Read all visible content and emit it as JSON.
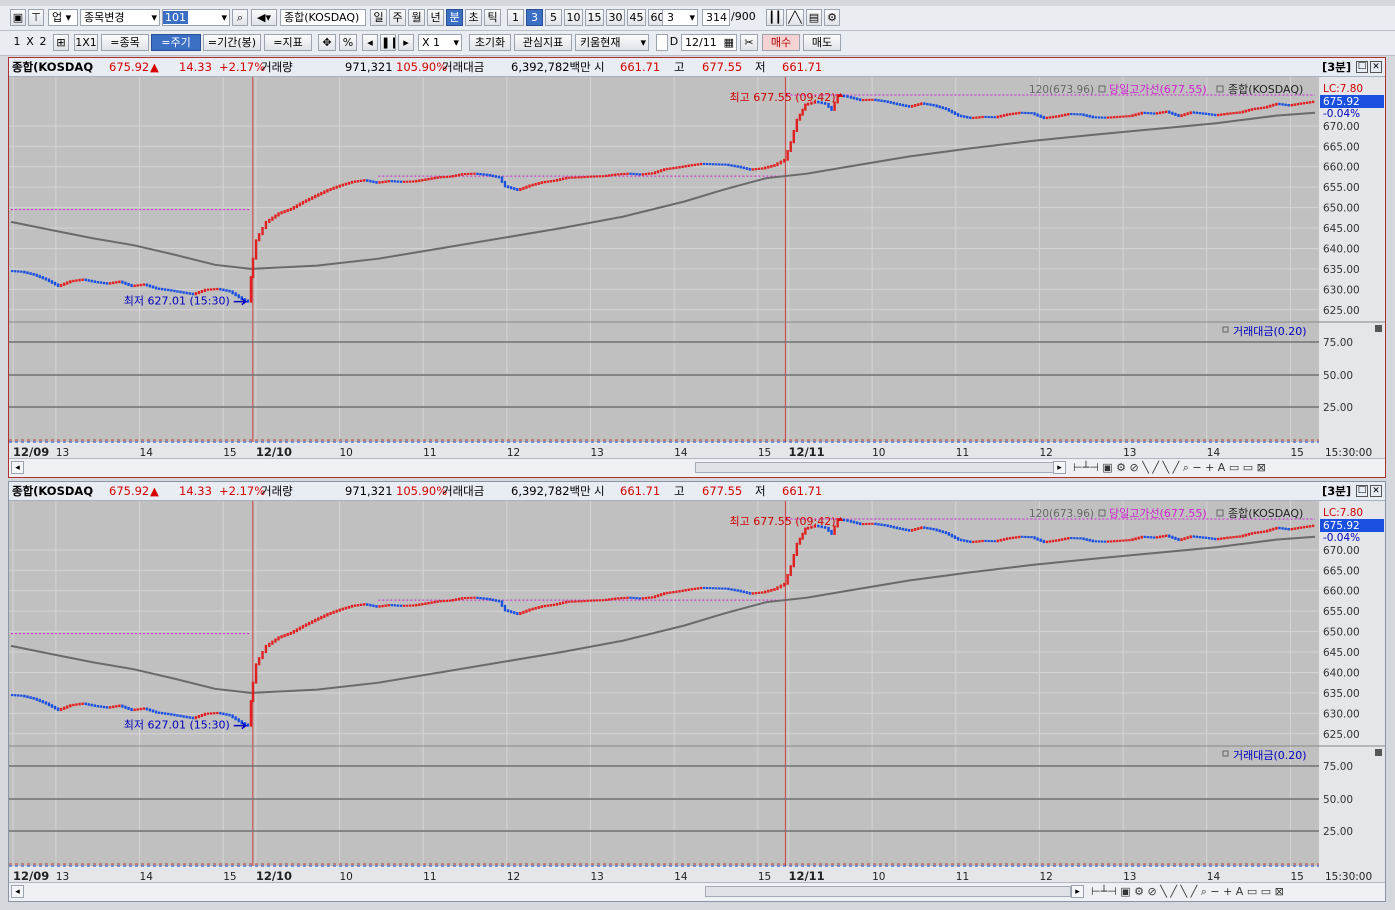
{
  "toolbar1": {
    "market_type": "업",
    "symbol_change_label": "종목변경",
    "symbol_code": "101",
    "symbol_name": "종합(KOSDAQ)",
    "period_buttons": [
      "일",
      "주",
      "월",
      "년",
      "분",
      "초",
      "틱"
    ],
    "period_selected": "분",
    "interval_buttons": [
      "1",
      "3",
      "5",
      "10",
      "15",
      "30",
      "45",
      "60"
    ],
    "interval_selected": "3",
    "interval_value": "3",
    "count_current": "314",
    "count_max": "/900"
  },
  "toolbar2": {
    "layout_1": "1",
    "layout_x": "X",
    "layout_2": "2",
    "layout_1x1": "1X1",
    "btn_symbol": "=종목",
    "btn_period": "=주기",
    "btn_range": "=기간(봉)",
    "btn_indicator": "=지표",
    "percent": "%",
    "zoom": "X 1",
    "btn_reset": "초기화",
    "btn_watch": "관심지표",
    "btn_kiwoom": "키움현재",
    "date_prefix": "D",
    "date_value": "12/11",
    "btn_buy": "매수",
    "btn_sell": "매도"
  },
  "panels": [
    {
      "header": {
        "name": "종합(KOSDAQ",
        "price": "675.92",
        "arrow": "▲",
        "change": "14.33",
        "change_pct": "+2.17%",
        "volume_label": "거래량",
        "volume": "971,321",
        "volume_ratio": "105.90%",
        "amount_label": "거래대금",
        "amount": "6,392,782백만",
        "open_label": "시",
        "open": "661.71",
        "high_label": "고",
        "high": "677.55",
        "low_label": "저",
        "low": "661.71",
        "interval_tag": "[3분]"
      }
    },
    {
      "header": {
        "name": "종합(KOSDAQ",
        "price": "675.92",
        "arrow": "▲",
        "change": "14.33",
        "change_pct": "+2.17%",
        "volume_label": "거래량",
        "volume": "971,321",
        "volume_ratio": "105.90%",
        "amount_label": "거래대금",
        "amount": "6,392,782백만",
        "open_label": "시",
        "open": "661.71",
        "high_label": "고",
        "high": "677.55",
        "low_label": "저",
        "low": "661.71",
        "interval_tag": "[3분]"
      }
    }
  ],
  "chart_data": {
    "type": "candlestick",
    "y_range": [
      622.5,
      680
    ],
    "y_ticks": [
      "670.00",
      "665.00",
      "660.00",
      "655.00",
      "650.00",
      "645.00",
      "640.00",
      "635.00",
      "630.00",
      "625.00"
    ],
    "current_label": "675.92",
    "lc_label": "LC:7.80",
    "change_label": "-0.04%",
    "high_annotation": "최고 677.55 (09:42)",
    "low_annotation": "최저 627.01 (15:30)",
    "ma_legend": "120(673.96)",
    "highline_legend": "당일고가선(677.55)",
    "series_legend": "종합(KOSDAQ)",
    "price_path": [
      [
        0,
        634.5
      ],
      [
        12,
        634.3
      ],
      [
        24,
        633.6
      ],
      [
        36,
        632.4
      ],
      [
        48,
        630.8
      ],
      [
        60,
        632.0
      ],
      [
        72,
        632.4
      ],
      [
        84,
        631.8
      ],
      [
        96,
        631.4
      ],
      [
        108,
        631.9
      ],
      [
        120,
        630.8
      ],
      [
        132,
        631.2
      ],
      [
        144,
        630.2
      ],
      [
        156,
        629.8
      ],
      [
        168,
        629.3
      ],
      [
        180,
        628.8
      ],
      [
        192,
        629.9
      ],
      [
        204,
        630.1
      ],
      [
        216,
        629.5
      ],
      [
        228,
        627.6
      ],
      [
        234,
        627.0
      ],
      [
        236,
        633.0
      ],
      [
        242,
        642.0
      ],
      [
        252,
        646.5
      ],
      [
        264,
        648.6
      ],
      [
        276,
        649.7
      ],
      [
        288,
        651.4
      ],
      [
        300,
        652.9
      ],
      [
        312,
        654.3
      ],
      [
        324,
        655.4
      ],
      [
        336,
        656.3
      ],
      [
        348,
        656.7
      ],
      [
        360,
        656.1
      ],
      [
        372,
        656.5
      ],
      [
        384,
        656.3
      ],
      [
        396,
        656.4
      ],
      [
        408,
        656.9
      ],
      [
        420,
        657.4
      ],
      [
        432,
        657.6
      ],
      [
        444,
        658.2
      ],
      [
        456,
        658.3
      ],
      [
        468,
        658.0
      ],
      [
        480,
        657.4
      ],
      [
        486,
        655.2
      ],
      [
        498,
        654.3
      ],
      [
        510,
        655.4
      ],
      [
        522,
        656.2
      ],
      [
        534,
        656.6
      ],
      [
        546,
        657.3
      ],
      [
        558,
        657.4
      ],
      [
        570,
        657.6
      ],
      [
        582,
        657.7
      ],
      [
        594,
        658.1
      ],
      [
        606,
        658.3
      ],
      [
        618,
        658.1
      ],
      [
        630,
        658.4
      ],
      [
        642,
        659.4
      ],
      [
        654,
        659.8
      ],
      [
        666,
        660.3
      ],
      [
        678,
        660.7
      ],
      [
        690,
        660.6
      ],
      [
        702,
        660.5
      ],
      [
        714,
        660.0
      ],
      [
        726,
        659.3
      ],
      [
        738,
        659.6
      ],
      [
        750,
        660.4
      ],
      [
        760,
        661.7
      ],
      [
        766,
        666.0
      ],
      [
        772,
        671.5
      ],
      [
        780,
        675.2
      ],
      [
        790,
        675.9
      ],
      [
        800,
        675.4
      ],
      [
        806,
        673.9
      ],
      [
        812,
        677.55
      ],
      [
        822,
        677.1
      ],
      [
        834,
        676.3
      ],
      [
        846,
        676.4
      ],
      [
        858,
        676.0
      ],
      [
        870,
        675.3
      ],
      [
        882,
        674.7
      ],
      [
        894,
        675.5
      ],
      [
        906,
        675.0
      ],
      [
        918,
        674.1
      ],
      [
        930,
        672.5
      ],
      [
        942,
        671.9
      ],
      [
        954,
        672.2
      ],
      [
        966,
        672.1
      ],
      [
        978,
        672.8
      ],
      [
        990,
        673.2
      ],
      [
        1002,
        673.1
      ],
      [
        1014,
        671.9
      ],
      [
        1026,
        672.3
      ],
      [
        1038,
        672.9
      ],
      [
        1050,
        672.8
      ],
      [
        1062,
        672.1
      ],
      [
        1074,
        672.0
      ],
      [
        1086,
        672.2
      ],
      [
        1098,
        672.4
      ],
      [
        1110,
        673.2
      ],
      [
        1122,
        673.0
      ],
      [
        1134,
        673.5
      ],
      [
        1146,
        672.4
      ],
      [
        1158,
        673.3
      ],
      [
        1170,
        673.0
      ],
      [
        1182,
        672.6
      ],
      [
        1194,
        673.0
      ],
      [
        1206,
        673.3
      ],
      [
        1218,
        674.1
      ],
      [
        1230,
        674.5
      ],
      [
        1242,
        675.4
      ],
      [
        1254,
        675.0
      ],
      [
        1266,
        675.5
      ],
      [
        1278,
        675.92
      ]
    ],
    "ma_path": [
      [
        0,
        646.5
      ],
      [
        40,
        644.5
      ],
      [
        80,
        642.5
      ],
      [
        120,
        640.8
      ],
      [
        160,
        638.5
      ],
      [
        200,
        636.0
      ],
      [
        235,
        635.0
      ],
      [
        300,
        635.8
      ],
      [
        360,
        637.5
      ],
      [
        420,
        640.0
      ],
      [
        480,
        642.5
      ],
      [
        540,
        645.0
      ],
      [
        600,
        647.8
      ],
      [
        660,
        651.5
      ],
      [
        700,
        654.5
      ],
      [
        740,
        657.2
      ],
      [
        780,
        658.3
      ],
      [
        820,
        660.0
      ],
      [
        880,
        662.5
      ],
      [
        940,
        664.5
      ],
      [
        1000,
        666.3
      ],
      [
        1060,
        667.8
      ],
      [
        1120,
        669.2
      ],
      [
        1180,
        670.6
      ],
      [
        1240,
        672.5
      ],
      [
        1278,
        673.2
      ]
    ],
    "prev_high_levels": [
      {
        "x0": 0,
        "x1": 235,
        "y": 649.5
      },
      {
        "x0": 360,
        "x1": 760,
        "y": 657.7
      },
      {
        "x0": 760,
        "x1": 1278,
        "y": 677.55
      }
    ],
    "dividers_x": [
      235,
      757
    ],
    "sub_indicator": {
      "legend": "거래대금(0.20)",
      "ticks": [
        "75.00",
        "50.00",
        "25.00"
      ]
    },
    "x_labels": [
      {
        "x": 0,
        "t": "12/09",
        "bold": true
      },
      {
        "x": 42,
        "t": "13"
      },
      {
        "x": 124,
        "t": "14"
      },
      {
        "x": 206,
        "t": "15"
      },
      {
        "x": 238,
        "t": "12/10",
        "bold": true
      },
      {
        "x": 320,
        "t": "10"
      },
      {
        "x": 402,
        "t": "11"
      },
      {
        "x": 484,
        "t": "12"
      },
      {
        "x": 566,
        "t": "13"
      },
      {
        "x": 648,
        "t": "14"
      },
      {
        "x": 730,
        "t": "15"
      },
      {
        "x": 760,
        "t": "12/11",
        "bold": true
      },
      {
        "x": 842,
        "t": "10"
      },
      {
        "x": 924,
        "t": "11"
      },
      {
        "x": 1006,
        "t": "12"
      },
      {
        "x": 1088,
        "t": "13"
      },
      {
        "x": 1170,
        "t": "14"
      },
      {
        "x": 1252,
        "t": "15"
      }
    ],
    "time_label": "15:30:00"
  }
}
